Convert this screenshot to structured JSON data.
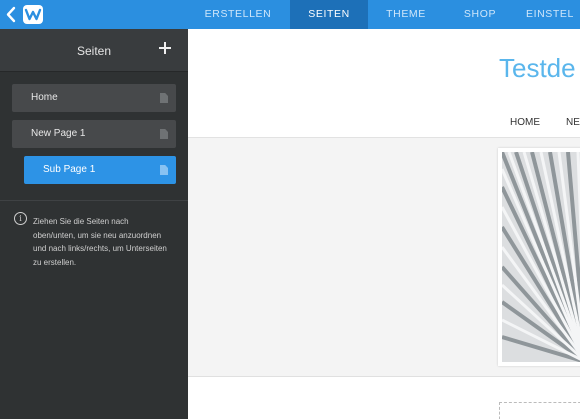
{
  "topbar": {
    "tabs": [
      {
        "label": "ERSTELLEN",
        "active": false
      },
      {
        "label": "SEITEN",
        "active": true
      },
      {
        "label": "THEME",
        "active": false
      },
      {
        "label": "SHOP",
        "active": false
      },
      {
        "label": "EINSTEL",
        "active": false
      }
    ],
    "colors": {
      "bar": "#2b8fe0",
      "active_tab": "#1d70b8"
    }
  },
  "sidebar": {
    "title": "Seiten",
    "add_icon": "plus-icon",
    "pages": [
      {
        "label": "Home",
        "selected": false,
        "icon": "page-icon"
      },
      {
        "label": "New Page 1",
        "selected": false,
        "icon": "page-icon"
      },
      {
        "label": "Sub Page 1",
        "selected": true,
        "icon": "page-icon"
      }
    ],
    "help_text": "Ziehen Sie die Seiten nach oben/unten, um sie neu anzuordnen und nach links/rechts, um Unterseiten zu erstellen."
  },
  "preview": {
    "site_title": "Testde",
    "nav": [
      "HOME",
      "NE"
    ]
  }
}
